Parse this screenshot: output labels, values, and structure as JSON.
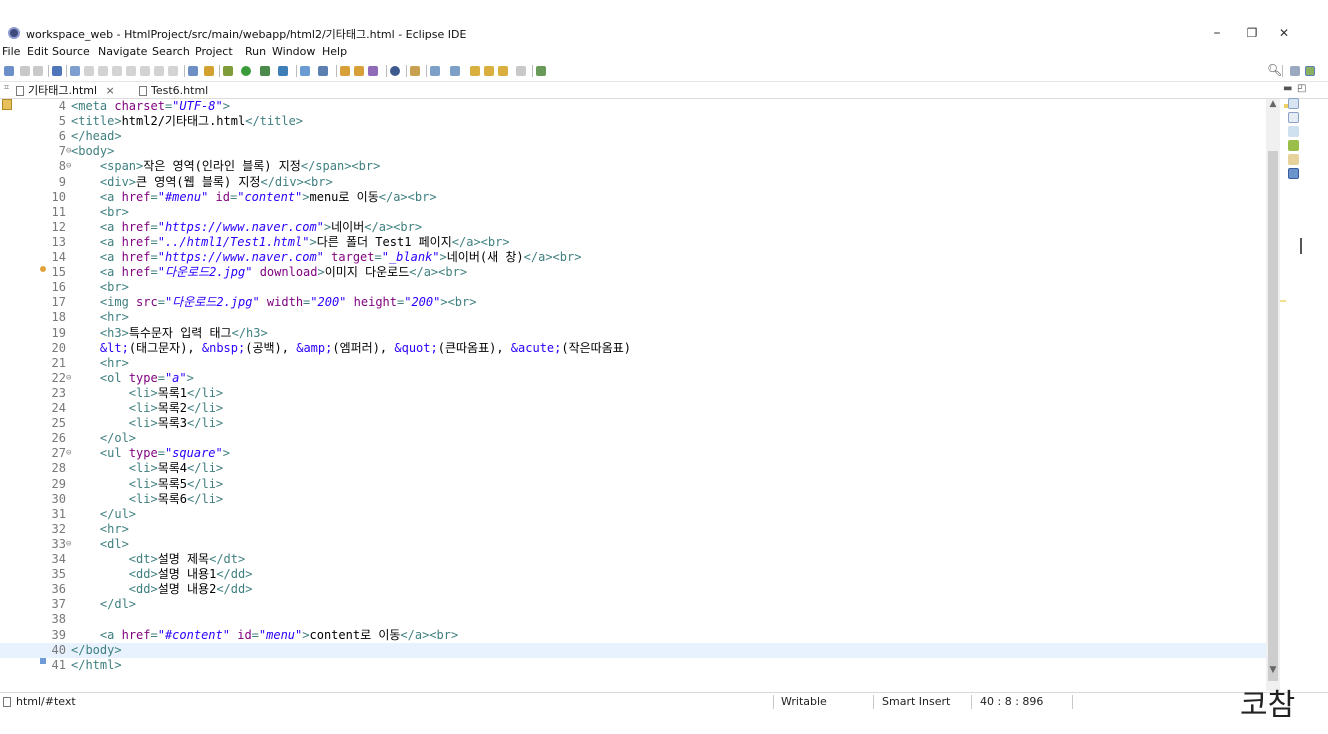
{
  "window": {
    "title": "workspace_web - HtmlProject/src/main/webapp/html2/기타태그.html - Eclipse IDE",
    "minimize": "–",
    "restore": "❐",
    "close": "✕"
  },
  "menu": [
    "File",
    "Edit",
    "Source",
    "Navigate",
    "Search",
    "Project",
    "Run",
    "Window",
    "Help"
  ],
  "tabs": [
    {
      "label": "기타태그.html",
      "close": "×",
      "active": true
    },
    {
      "label": "Test6.html",
      "active": false
    }
  ],
  "editor": {
    "current_line": "40",
    "lines": [
      {
        "n": "4",
        "fold": "",
        "segs": [
          [
            "t",
            "<meta "
          ],
          [
            "a",
            "charset"
          ],
          [
            "t",
            "="
          ],
          [
            "v",
            "\"UTF-8\""
          ],
          [
            "t",
            ">"
          ]
        ]
      },
      {
        "n": "5",
        "fold": "",
        "segs": [
          [
            "t",
            "<title>"
          ],
          [
            "x",
            "html2/기타태그.html"
          ],
          [
            "t",
            "</title>"
          ]
        ]
      },
      {
        "n": "6",
        "fold": "",
        "segs": [
          [
            "t",
            "</head>"
          ]
        ]
      },
      {
        "n": "7",
        "fold": "⊖",
        "segs": [
          [
            "t",
            "<body>"
          ]
        ]
      },
      {
        "n": "8",
        "fold": "⊖",
        "segs": [
          [
            "x",
            "    "
          ],
          [
            "t",
            "<span>"
          ],
          [
            "x",
            "작은 영역(인라인 블록) 지정"
          ],
          [
            "t",
            "</span><br>"
          ]
        ]
      },
      {
        "n": "9",
        "fold": "",
        "segs": [
          [
            "x",
            "    "
          ],
          [
            "t",
            "<div>"
          ],
          [
            "x",
            "큰 영역(웹 블록) 지정"
          ],
          [
            "t",
            "</div><br>"
          ]
        ]
      },
      {
        "n": "10",
        "fold": "",
        "segs": [
          [
            "x",
            "    "
          ],
          [
            "t",
            "<a "
          ],
          [
            "a",
            "href"
          ],
          [
            "t",
            "="
          ],
          [
            "v",
            "\"#menu\""
          ],
          [
            "x",
            " "
          ],
          [
            "a",
            "id"
          ],
          [
            "t",
            "="
          ],
          [
            "v",
            "\"content\""
          ],
          [
            "t",
            ">"
          ],
          [
            "x",
            "menu로 이동"
          ],
          [
            "t",
            "</a><br>"
          ]
        ]
      },
      {
        "n": "11",
        "fold": "",
        "segs": [
          [
            "x",
            "    "
          ],
          [
            "t",
            "<br>"
          ]
        ]
      },
      {
        "n": "12",
        "fold": "",
        "segs": [
          [
            "x",
            "    "
          ],
          [
            "t",
            "<a "
          ],
          [
            "a",
            "href"
          ],
          [
            "t",
            "="
          ],
          [
            "v",
            "\"https://www.naver.com\""
          ],
          [
            "t",
            ">"
          ],
          [
            "x",
            "네이버"
          ],
          [
            "t",
            "</a><br>"
          ]
        ]
      },
      {
        "n": "13",
        "fold": "",
        "segs": [
          [
            "x",
            "    "
          ],
          [
            "t",
            "<a "
          ],
          [
            "a",
            "href"
          ],
          [
            "t",
            "="
          ],
          [
            "v",
            "\"../html1/Test1.html\""
          ],
          [
            "t",
            ">"
          ],
          [
            "x",
            "다른 폴더 Test1 페이지"
          ],
          [
            "t",
            "</a><br>"
          ]
        ]
      },
      {
        "n": "14",
        "fold": "",
        "segs": [
          [
            "x",
            "    "
          ],
          [
            "t",
            "<a "
          ],
          [
            "a",
            "href"
          ],
          [
            "t",
            "="
          ],
          [
            "v",
            "\"https://www.naver.com\""
          ],
          [
            "x",
            " "
          ],
          [
            "a",
            "target"
          ],
          [
            "t",
            "="
          ],
          [
            "v",
            "\"_blank\""
          ],
          [
            "t",
            ">"
          ],
          [
            "x",
            "네이버(새 창)"
          ],
          [
            "t",
            "</a><br>"
          ]
        ]
      },
      {
        "n": "15",
        "fold": "",
        "segs": [
          [
            "x",
            "    "
          ],
          [
            "t",
            "<a "
          ],
          [
            "a",
            "href"
          ],
          [
            "t",
            "="
          ],
          [
            "v",
            "\"다운로드2.jpg\""
          ],
          [
            "x",
            " "
          ],
          [
            "a",
            "download"
          ],
          [
            "t",
            ">"
          ],
          [
            "x",
            "이미지 다운로드"
          ],
          [
            "t",
            "</a><br>"
          ]
        ]
      },
      {
        "n": "16",
        "fold": "",
        "segs": [
          [
            "x",
            "    "
          ],
          [
            "t",
            "<br>"
          ]
        ]
      },
      {
        "n": "17",
        "fold": "",
        "segs": [
          [
            "x",
            "    "
          ],
          [
            "t",
            "<img "
          ],
          [
            "a",
            "src"
          ],
          [
            "t",
            "="
          ],
          [
            "v",
            "\"다운로드2.jpg\""
          ],
          [
            "x",
            " "
          ],
          [
            "a",
            "width"
          ],
          [
            "t",
            "="
          ],
          [
            "v",
            "\"200\""
          ],
          [
            "x",
            " "
          ],
          [
            "a",
            "height"
          ],
          [
            "t",
            "="
          ],
          [
            "v",
            "\"200\""
          ],
          [
            "t",
            "><br>"
          ]
        ]
      },
      {
        "n": "18",
        "fold": "",
        "segs": [
          [
            "x",
            "    "
          ],
          [
            "t",
            "<hr>"
          ]
        ]
      },
      {
        "n": "19",
        "fold": "",
        "segs": [
          [
            "x",
            "    "
          ],
          [
            "t",
            "<h3>"
          ],
          [
            "x",
            "특수문자 입력 태그"
          ],
          [
            "t",
            "</h3>"
          ]
        ]
      },
      {
        "n": "20",
        "fold": "",
        "segs": [
          [
            "x",
            "    "
          ],
          [
            "e",
            "&lt;"
          ],
          [
            "x",
            "(태그문자), "
          ],
          [
            "e",
            "&nbsp;"
          ],
          [
            "x",
            "(공백), "
          ],
          [
            "e",
            "&amp;"
          ],
          [
            "x",
            "(엠퍼러), "
          ],
          [
            "e",
            "&quot;"
          ],
          [
            "x",
            "(큰따옴표), "
          ],
          [
            "e",
            "&acute;"
          ],
          [
            "x",
            "(작은따옴표)"
          ]
        ]
      },
      {
        "n": "21",
        "fold": "",
        "segs": [
          [
            "x",
            "    "
          ],
          [
            "t",
            "<hr>"
          ]
        ]
      },
      {
        "n": "22",
        "fold": "⊖",
        "segs": [
          [
            "x",
            "    "
          ],
          [
            "t",
            "<ol "
          ],
          [
            "a",
            "type"
          ],
          [
            "t",
            "="
          ],
          [
            "v",
            "\"a\""
          ],
          [
            "t",
            ">"
          ]
        ]
      },
      {
        "n": "23",
        "fold": "",
        "segs": [
          [
            "x",
            "        "
          ],
          [
            "t",
            "<li>"
          ],
          [
            "x",
            "목록1"
          ],
          [
            "t",
            "</li>"
          ]
        ]
      },
      {
        "n": "24",
        "fold": "",
        "segs": [
          [
            "x",
            "        "
          ],
          [
            "t",
            "<li>"
          ],
          [
            "x",
            "목록2"
          ],
          [
            "t",
            "</li>"
          ]
        ]
      },
      {
        "n": "25",
        "fold": "",
        "segs": [
          [
            "x",
            "        "
          ],
          [
            "t",
            "<li>"
          ],
          [
            "x",
            "목록3"
          ],
          [
            "t",
            "</li>"
          ]
        ]
      },
      {
        "n": "26",
        "fold": "",
        "segs": [
          [
            "x",
            "    "
          ],
          [
            "t",
            "</ol>"
          ]
        ]
      },
      {
        "n": "27",
        "fold": "⊖",
        "segs": [
          [
            "x",
            "    "
          ],
          [
            "t",
            "<ul "
          ],
          [
            "a",
            "type"
          ],
          [
            "t",
            "="
          ],
          [
            "v",
            "\"square\""
          ],
          [
            "t",
            ">"
          ]
        ]
      },
      {
        "n": "28",
        "fold": "",
        "segs": [
          [
            "x",
            "        "
          ],
          [
            "t",
            "<li>"
          ],
          [
            "x",
            "목록4"
          ],
          [
            "t",
            "</li>"
          ]
        ]
      },
      {
        "n": "29",
        "fold": "",
        "segs": [
          [
            "x",
            "        "
          ],
          [
            "t",
            "<li>"
          ],
          [
            "x",
            "목록5"
          ],
          [
            "t",
            "</li>"
          ]
        ]
      },
      {
        "n": "30",
        "fold": "",
        "segs": [
          [
            "x",
            "        "
          ],
          [
            "t",
            "<li>"
          ],
          [
            "x",
            "목록6"
          ],
          [
            "t",
            "</li>"
          ]
        ]
      },
      {
        "n": "31",
        "fold": "",
        "segs": [
          [
            "x",
            "    "
          ],
          [
            "t",
            "</ul>"
          ]
        ]
      },
      {
        "n": "32",
        "fold": "",
        "segs": [
          [
            "x",
            "    "
          ],
          [
            "t",
            "<hr>"
          ]
        ]
      },
      {
        "n": "33",
        "fold": "⊖",
        "segs": [
          [
            "x",
            "    "
          ],
          [
            "t",
            "<dl>"
          ]
        ]
      },
      {
        "n": "34",
        "fold": "",
        "segs": [
          [
            "x",
            "        "
          ],
          [
            "t",
            "<dt>"
          ],
          [
            "x",
            "설명 제목"
          ],
          [
            "t",
            "</dt>"
          ]
        ]
      },
      {
        "n": "35",
        "fold": "",
        "segs": [
          [
            "x",
            "        "
          ],
          [
            "t",
            "<dd>"
          ],
          [
            "x",
            "설명 내용1"
          ],
          [
            "t",
            "</dd>"
          ]
        ]
      },
      {
        "n": "36",
        "fold": "",
        "segs": [
          [
            "x",
            "        "
          ],
          [
            "t",
            "<dd>"
          ],
          [
            "x",
            "설명 내용2"
          ],
          [
            "t",
            "</dd>"
          ]
        ]
      },
      {
        "n": "37",
        "fold": "",
        "segs": [
          [
            "x",
            "    "
          ],
          [
            "t",
            "</dl>"
          ]
        ]
      },
      {
        "n": "38",
        "fold": "",
        "segs": []
      },
      {
        "n": "39",
        "fold": "",
        "segs": [
          [
            "x",
            "    "
          ],
          [
            "t",
            "<a "
          ],
          [
            "a",
            "href"
          ],
          [
            "t",
            "="
          ],
          [
            "v",
            "\"#content\""
          ],
          [
            "x",
            " "
          ],
          [
            "a",
            "id"
          ],
          [
            "t",
            "="
          ],
          [
            "v",
            "\"menu\""
          ],
          [
            "t",
            ">"
          ],
          [
            "x",
            "content로 이동"
          ],
          [
            "t",
            "</a><br>"
          ]
        ]
      },
      {
        "n": "40",
        "fold": "",
        "segs": [
          [
            "t",
            "</body>"
          ]
        ]
      },
      {
        "n": "41",
        "fold": "",
        "segs": [
          [
            "t",
            "</html>"
          ]
        ]
      }
    ]
  },
  "status": {
    "path": "html/#text",
    "writable": "Writable",
    "insert_mode": "Smart Insert",
    "position": "40 : 8 : 896"
  },
  "overlay": "코참"
}
